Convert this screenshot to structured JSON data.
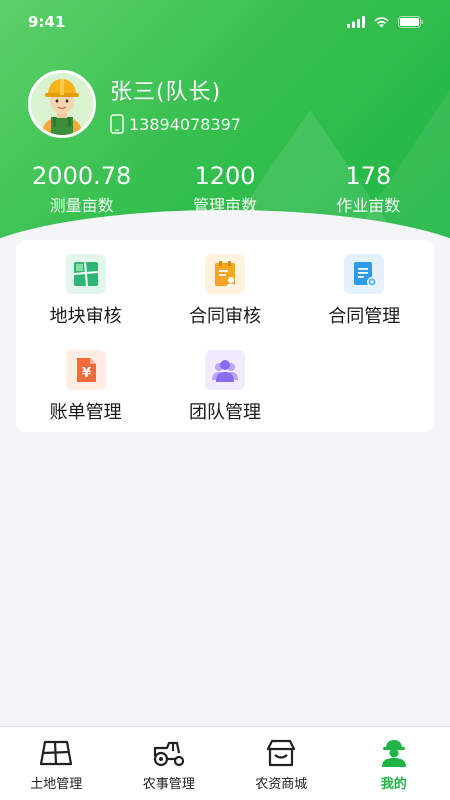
{
  "status_bar": {
    "time": "9:41"
  },
  "profile": {
    "name": "张三(队长)",
    "phone": "13894078397"
  },
  "stats": [
    {
      "value": "2000.78",
      "label": "测量亩数"
    },
    {
      "value": "1200",
      "label": "管理亩数"
    },
    {
      "value": "178",
      "label": "作业亩数"
    }
  ],
  "menu": [
    {
      "label": "地块审核",
      "icon": "land-plot-icon",
      "color": "#2bb673"
    },
    {
      "label": "合同审核",
      "icon": "contract-review-icon",
      "color": "#f5a623"
    },
    {
      "label": "合同管理",
      "icon": "contract-manage-icon",
      "color": "#2d9cf0"
    },
    {
      "label": "账单管理",
      "icon": "bill-icon",
      "color": "#f36b3b"
    },
    {
      "label": "团队管理",
      "icon": "team-icon",
      "color": "#8a6cf2"
    }
  ],
  "tabs": [
    {
      "label": "土地管理",
      "icon": "land-map-icon"
    },
    {
      "label": "农事管理",
      "icon": "tractor-icon"
    },
    {
      "label": "农资商城",
      "icon": "store-icon"
    },
    {
      "label": "我的",
      "icon": "farmer-icon",
      "active": true
    }
  ],
  "colors": {
    "brand_green": "#1fb545",
    "background": "#f4f5f7"
  }
}
